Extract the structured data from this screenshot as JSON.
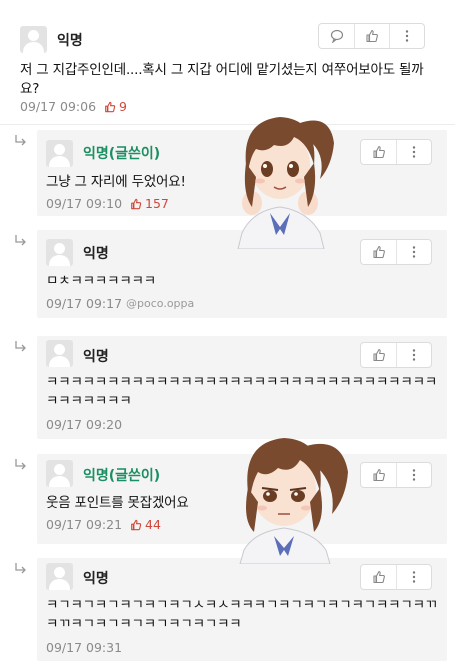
{
  "post": {
    "author": "익명",
    "text": "저 그 지갑주인인데....혹시 그 지갑 어디에 맡기셨는지 여쭈어보아도 될까요?",
    "time": "09/17 09:06",
    "likes": "9"
  },
  "replies": [
    {
      "author": "익명(글쓴이)",
      "text": "그냥 그 자리에 두었어요!",
      "time": "09/17 09:10",
      "likes": "157"
    },
    {
      "author": "익명",
      "text": "ㅁㅊㅋㅋㅋㅋㅋㅋㅋ",
      "time": "09/17 09:17",
      "handle": "@poco.oppa"
    },
    {
      "author": "익명",
      "text": "ㅋㅋㅋㅋㅋㅋㅋㅋㅋㅋㅋㅋㅋㅋㅋㅋㅋㅋㅋㅋㅋㅋㅋㅋㅋㅋㅋㅋㅋㅋㅋㅋㅋㅋㅋㅋㅋㅋㅋ",
      "time": "09/17 09:20"
    },
    {
      "author": "익명(글쓴이)",
      "text": "웃음 포인트를 못잡겠어요",
      "time": "09/17 09:21",
      "likes": "44"
    },
    {
      "author": "익명",
      "text": "ㅋㄱㅋㄱㅋㄱㅋㄱㅋㄱㅋㄱㅅㅋㅅㅋㅋㅋㄱㅋㄱㅋㄱㅋㄱㅋㄱㅋㅋㄱㅋㄲㅋㄲㅋㄱㅋㄱㅋㄱㅋㄱㅋㄱㅋㄱㅋㅋ",
      "time": "09/17 09:31"
    }
  ],
  "icons": {
    "comment": "speech-bubble-icon",
    "like": "thumbs-up-icon",
    "more": "vertical-dots-icon",
    "reply": "reply-arrow-icon"
  },
  "colors": {
    "author": "#1b8f63",
    "likes": "#d0483a",
    "reply_bg": "#f4f4f4"
  }
}
